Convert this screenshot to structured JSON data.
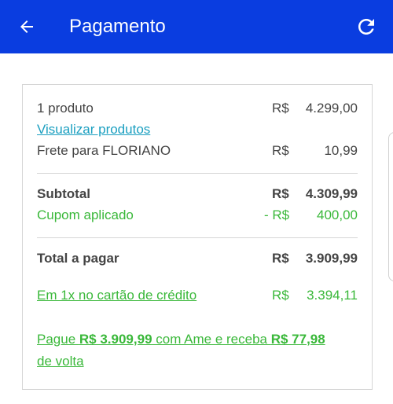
{
  "header": {
    "title": "Pagamento",
    "back_icon": "arrow-left-icon",
    "refresh_icon": "refresh-icon",
    "bg_color": "#0a3de0"
  },
  "summary": {
    "products": {
      "label": "1 produto",
      "currency": "R$",
      "amount": "4.299,00"
    },
    "view_products_link": "Visualizar produtos",
    "shipping": {
      "label": "Frete para FLORIANO",
      "currency": "R$",
      "amount": "10,99"
    },
    "subtotal": {
      "label": "Subtotal",
      "currency": "R$",
      "amount": "4.309,99"
    },
    "coupon": {
      "label": "Cupom aplicado",
      "currency": "- R$",
      "amount": "400,00"
    },
    "total": {
      "label": "Total a pagar",
      "currency": "R$",
      "amount": "3.909,99"
    },
    "credit": {
      "label": "Em 1x no cartão de crédito",
      "currency": "R$",
      "amount": "3.394,11"
    },
    "ame": {
      "prefix": "Pague ",
      "pay_amount": "R$ 3.909,99",
      "middle": " com Ame e receba ",
      "cashback": "R$ 77,98",
      "suffix": " de volta"
    }
  },
  "colors": {
    "green": "#3ab83a",
    "link": "#1a9fc0",
    "text": "#444444"
  }
}
